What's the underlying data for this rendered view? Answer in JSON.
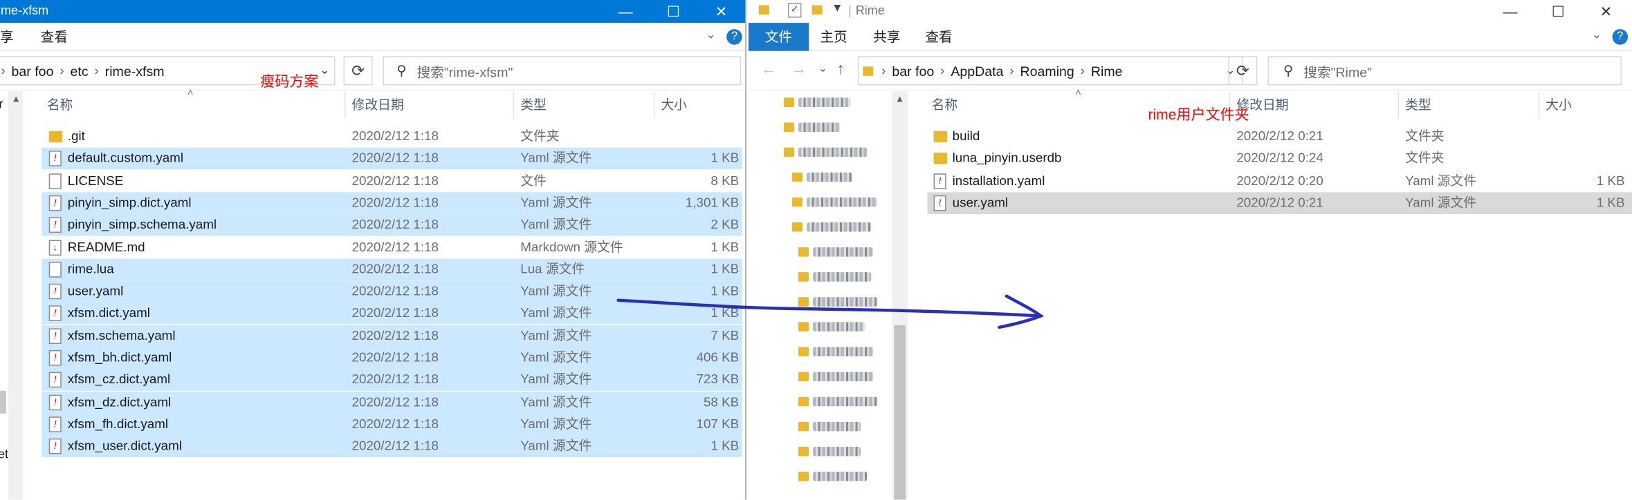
{
  "left_window": {
    "title": "rime-xfsm",
    "ribbon_tabs": [
      "享",
      "查看"
    ],
    "breadcrumb": [
      "bar foo",
      "etc",
      "rime-xfsm"
    ],
    "search_placeholder": "搜索\"rime-xfsm\"",
    "annotation": "瘦码方案",
    "side_fragments": [
      "r",
      "et"
    ],
    "columns": {
      "name": "名称",
      "date": "修改日期",
      "type": "类型",
      "size": "大小"
    },
    "files": [
      {
        "name": ".git",
        "date": "2020/2/12 1:18",
        "type": "文件夹",
        "size": "",
        "icon": "folder-icon",
        "selected": false
      },
      {
        "name": "default.custom.yaml",
        "date": "2020/2/12 1:18",
        "type": "Yaml 源文件",
        "size": "1 KB",
        "icon": "yaml-file-icon",
        "selected": true
      },
      {
        "name": "LICENSE",
        "date": "2020/2/12 1:18",
        "type": "文件",
        "size": "8 KB",
        "icon": "file-icon",
        "selected": false
      },
      {
        "name": "pinyin_simp.dict.yaml",
        "date": "2020/2/12 1:18",
        "type": "Yaml 源文件",
        "size": "1,301 KB",
        "icon": "yaml-file-icon",
        "selected": true
      },
      {
        "name": "pinyin_simp.schema.yaml",
        "date": "2020/2/12 1:18",
        "type": "Yaml 源文件",
        "size": "2 KB",
        "icon": "yaml-file-icon",
        "selected": true
      },
      {
        "name": "README.md",
        "date": "2020/2/12 1:18",
        "type": "Markdown 源文件",
        "size": "1 KB",
        "icon": "markdown-file-icon",
        "selected": false
      },
      {
        "name": "rime.lua",
        "date": "2020/2/12 1:18",
        "type": "Lua 源文件",
        "size": "1 KB",
        "icon": "lua-file-icon",
        "selected": true
      },
      {
        "name": "user.yaml",
        "date": "2020/2/12 1:18",
        "type": "Yaml 源文件",
        "size": "1 KB",
        "icon": "yaml-file-icon",
        "selected": true
      },
      {
        "name": "xfsm.dict.yaml",
        "date": "2020/2/12 1:18",
        "type": "Yaml 源文件",
        "size": "1 KB",
        "icon": "yaml-file-icon",
        "selected": true
      },
      {
        "name": "xfsm.schema.yaml",
        "date": "2020/2/12 1:18",
        "type": "Yaml 源文件",
        "size": "7 KB",
        "icon": "yaml-file-icon",
        "selected": true
      },
      {
        "name": "xfsm_bh.dict.yaml",
        "date": "2020/2/12 1:18",
        "type": "Yaml 源文件",
        "size": "406 KB",
        "icon": "yaml-file-icon",
        "selected": true
      },
      {
        "name": "xfsm_cz.dict.yaml",
        "date": "2020/2/12 1:18",
        "type": "Yaml 源文件",
        "size": "723 KB",
        "icon": "yaml-file-icon",
        "selected": true
      },
      {
        "name": "xfsm_dz.dict.yaml",
        "date": "2020/2/12 1:18",
        "type": "Yaml 源文件",
        "size": "58 KB",
        "icon": "yaml-file-icon",
        "selected": true
      },
      {
        "name": "xfsm_fh.dict.yaml",
        "date": "2020/2/12 1:18",
        "type": "Yaml 源文件",
        "size": "107 KB",
        "icon": "yaml-file-icon",
        "selected": true
      },
      {
        "name": "xfsm_user.dict.yaml",
        "date": "2020/2/12 1:18",
        "type": "Yaml 源文件",
        "size": "1 KB",
        "icon": "yaml-file-icon",
        "selected": true
      }
    ]
  },
  "right_window": {
    "title": "Rime",
    "ribbon_tabs": [
      "文件",
      "主页",
      "共享",
      "查看"
    ],
    "breadcrumb": [
      "bar foo",
      "AppData",
      "Roaming",
      "Rime"
    ],
    "search_placeholder": "搜索\"Rime\"",
    "annotation": "rime用户文件夹",
    "columns": {
      "name": "名称",
      "date": "修改日期",
      "type": "类型",
      "size": "大小"
    },
    "files": [
      {
        "name": "build",
        "date": "2020/2/12 0:21",
        "type": "文件夹",
        "size": "",
        "icon": "folder-icon",
        "selected": false
      },
      {
        "name": "luna_pinyin.userdb",
        "date": "2020/2/12 0:24",
        "type": "文件夹",
        "size": "",
        "icon": "folder-icon",
        "selected": false
      },
      {
        "name": "installation.yaml",
        "date": "2020/2/12 0:20",
        "type": "Yaml 源文件",
        "size": "1 KB",
        "icon": "yaml-file-icon",
        "selected": false
      },
      {
        "name": "user.yaml",
        "date": "2020/2/12 0:21",
        "type": "Yaml 源文件",
        "size": "1 KB",
        "icon": "yaml-file-icon",
        "selected": "gray"
      }
    ]
  },
  "colors": {
    "titlebar_active": "#0078d7",
    "selection": "#cce8ff",
    "annotation": "#ff0000",
    "arrow": "#2b2fb8"
  }
}
